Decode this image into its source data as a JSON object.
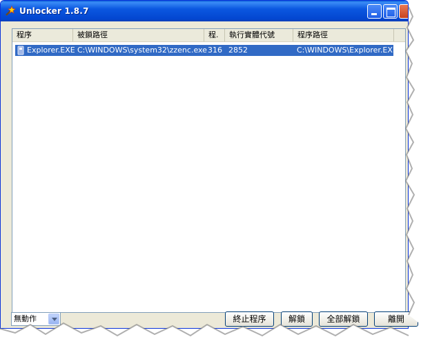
{
  "window": {
    "title": "Unlocker 1.8.7"
  },
  "list": {
    "columns": [
      "程序",
      "被鎖路徑",
      "程.",
      "執行實體代號",
      "程序路徑"
    ],
    "rows": [
      {
        "process": "Explorer.EXE",
        "locked_path": "C:\\WINDOWS\\system32\\zzenc.exe",
        "pid": "316",
        "handle": "2852",
        "process_path": "C:\\WINDOWS\\Explorer.EXE",
        "selected": true
      }
    ]
  },
  "footer": {
    "action_select": "無動作",
    "buttons": {
      "kill": "終止程序",
      "unlock": "解鎖",
      "unlock_all": "全部解鎖",
      "quit": "離開"
    }
  },
  "colors": {
    "title_bar": "#0a56df",
    "selection": "#316ac5"
  }
}
